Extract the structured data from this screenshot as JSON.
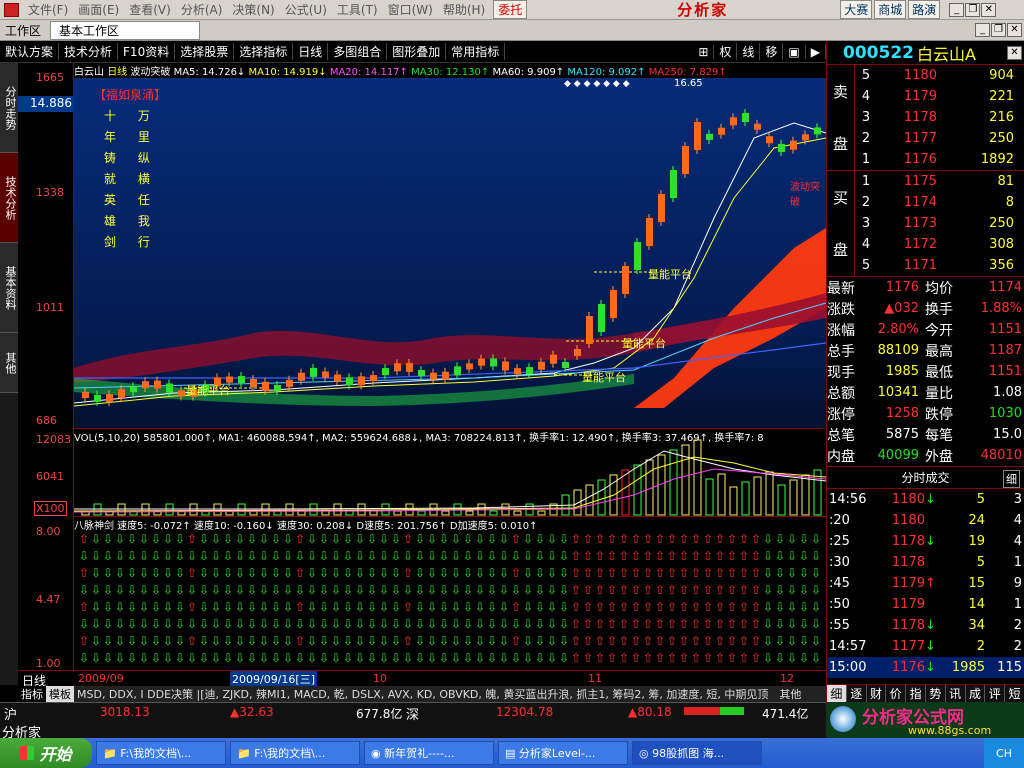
{
  "menubar": {
    "items": [
      "文件(F)",
      "画面(E)",
      "查看(V)",
      "分析(A)",
      "决策(N)",
      "公式(U)",
      "工具(T)",
      "窗口(W)",
      "帮助(H)"
    ],
    "weituo": "委托",
    "brand": "分析家",
    "btn_dasai": "大赛",
    "btn_shangcheng": "商城",
    "btn_luyan": "路演"
  },
  "tabbar": {
    "workspace": "工作区",
    "tab": "基本工作区"
  },
  "toolbar": {
    "items": [
      "默认方案",
      "技术分析",
      "F10资料",
      "选择股票",
      "选择指标",
      "日线",
      "多图组合",
      "图形叠加",
      "常用指标"
    ],
    "right_items": [
      "权",
      "线",
      "移"
    ]
  },
  "sidetabs": [
    "分时走势",
    "技术分析",
    "基本资料",
    "其他"
  ],
  "price_axis": {
    "labels": [
      "1665",
      "1338",
      "1011",
      "686"
    ],
    "current": "14.886"
  },
  "main_info": {
    "name": "白云山",
    "period": "日线",
    "indicator": "波动突破",
    "ma5": "MA5: 14.726↓",
    "ma10": "MA10: 14.919↓",
    "ma20": "MA20: 14.117↑",
    "ma30": "MA30: 12.130↑",
    "ma60": "MA60: 9.909↑",
    "ma120": "MA120: 9.092↑",
    "ma250": "MA250: 7.829↑"
  },
  "poem": {
    "title": "【福如泉涌】",
    "lines": [
      "十 万",
      "年 里",
      "铸 纵",
      "就 横",
      "英 任",
      "雄 我",
      "剑 行"
    ]
  },
  "annotations": {
    "platform": "量能平台",
    "peak": "16.65",
    "breakout": "波动突破"
  },
  "volume": {
    "axis": [
      "12083",
      "6041",
      "X100"
    ],
    "info": "VOL(5,10,20) 585801.000↑, MA1: 460088.594↑, MA2: 559624.688↓, MA3: 708224.813↑, 换手率1: 12.490↑, 换手率3: 37.469↑, 换手率7: 8"
  },
  "bamai": {
    "axis": [
      "8.00",
      "4.47",
      "1.00"
    ],
    "info": "八脉神剑 速度5: -0.072↑ 速度10: -0.160↓ 速度30: 0.208↓ D速度5: 201.756↑ D加速度5: 0.010↑"
  },
  "datebar": {
    "period": "日线",
    "d1": "2009/09",
    "d2": "2009/09/16[三]",
    "d3": "10",
    "d4": "11",
    "d5": "12"
  },
  "bottom_tabs": {
    "label1": "指标",
    "label2": "模板",
    "list": "MSD, DDX, I DDE决策 |[迪, ZJKD, 辣MI1, MACD, 乾, DSLX, AVX, KD, OBVKD, 魄, 黄买蓝出升浪, 抓主1, 筹码2, 筹, 加速度, 短, 中期见顶",
    "other": "其他"
  },
  "status": {
    "sh": "沪",
    "sh_index": "3018.13",
    "sh_chg": "▲32.63",
    "sh_amt": "677.8亿",
    "sz": "深",
    "sz_index": "12304.78",
    "sz_chg": "▲80.18",
    "sz_amt": "471.4亿",
    "app": "分析家"
  },
  "stock": {
    "code": "000522",
    "name": "白云山A"
  },
  "orderbook": {
    "sell_label": [
      "卖",
      "盘"
    ],
    "buy_label": [
      "买",
      "盘"
    ],
    "sell": [
      {
        "lvl": "5",
        "price": "1180",
        "vol": "904"
      },
      {
        "lvl": "4",
        "price": "1179",
        "vol": "221"
      },
      {
        "lvl": "3",
        "price": "1178",
        "vol": "216"
      },
      {
        "lvl": "2",
        "price": "1177",
        "vol": "250"
      },
      {
        "lvl": "1",
        "price": "1176",
        "vol": "1892"
      }
    ],
    "buy": [
      {
        "lvl": "1",
        "price": "1175",
        "vol": "81"
      },
      {
        "lvl": "2",
        "price": "1174",
        "vol": "8"
      },
      {
        "lvl": "3",
        "price": "1173",
        "vol": "250"
      },
      {
        "lvl": "4",
        "price": "1172",
        "vol": "308"
      },
      {
        "lvl": "5",
        "price": "1171",
        "vol": "356"
      }
    ]
  },
  "quote": [
    {
      "k1": "最新",
      "v1": "1176",
      "k2": "均价",
      "v2": "1174"
    },
    {
      "k1": "涨跌",
      "v1": "▲032",
      "k2": "换手",
      "v2": "1.88%"
    },
    {
      "k1": "涨幅",
      "v1": "2.80%",
      "k2": "今开",
      "v2": "1151"
    },
    {
      "k1": "总手",
      "v1": "88109",
      "k2": "最高",
      "v2": "1187"
    },
    {
      "k1": "现手",
      "v1": "1985",
      "k2": "最低",
      "v2": "1151"
    },
    {
      "k1": "总额",
      "v1": "10341",
      "k2": "量比",
      "v2": "1.08"
    },
    {
      "k1": "涨停",
      "v1": "1258",
      "k2": "跌停",
      "v2": "1030"
    },
    {
      "k1": "总笔",
      "v1": "5875",
      "k2": "每笔",
      "v2": "15.0"
    },
    {
      "k1": "内盘",
      "v1": "40099",
      "k2": "外盘",
      "v2": "48010"
    }
  ],
  "ticks_header": {
    "title": "分时成交",
    "detail": "细"
  },
  "ticks": [
    {
      "t": "14:56",
      "p": "1180",
      "a": "↓",
      "v": "5",
      "n": "3"
    },
    {
      "t": ":20",
      "p": "1180",
      "a": "",
      "v": "24",
      "n": "4"
    },
    {
      "t": ":25",
      "p": "1178",
      "a": "↓",
      "v": "19",
      "n": "4"
    },
    {
      "t": ":30",
      "p": "1178",
      "a": "",
      "v": "5",
      "n": "1"
    },
    {
      "t": ":45",
      "p": "1179",
      "a": "↑",
      "v": "15",
      "n": "9"
    },
    {
      "t": ":50",
      "p": "1179",
      "a": "",
      "v": "14",
      "n": "1"
    },
    {
      "t": ":55",
      "p": "1178",
      "a": "↓",
      "v": "34",
      "n": "2"
    },
    {
      "t": "14:57",
      "p": "1177",
      "a": "↓",
      "v": "2",
      "n": "2"
    },
    {
      "t": "15:00",
      "p": "1176",
      "a": "↓",
      "v": "1985",
      "n": "115"
    }
  ],
  "rp_tabs": [
    "细",
    "逐",
    "财",
    "价",
    "指",
    "势",
    "讯",
    "成",
    "评",
    "短"
  ],
  "watermark": {
    "text": "分析家公式网",
    "url": "www.88gs.com"
  },
  "taskbar": {
    "start": "开始",
    "tasks": [
      "F:\\我的文档\\...",
      "F:\\我的文档\\...",
      "新年贺礼----...",
      "分析家Level-...",
      "98股抓图 海..."
    ],
    "tray": "CH"
  },
  "colors": {
    "up": "#ff3030",
    "down": "#20e020",
    "panel_border": "#880000",
    "candle_up": "#ff6a1a"
  }
}
